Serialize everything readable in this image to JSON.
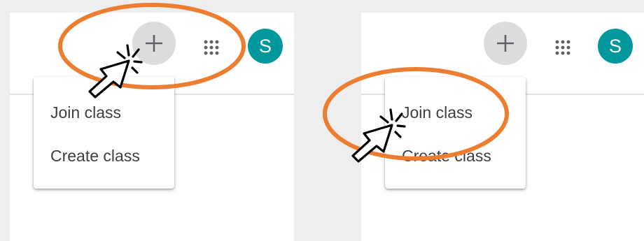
{
  "colors": {
    "avatar_bg": "#00979d",
    "icon": "#5f6368",
    "annotation": "#ed7d31"
  },
  "panels": [
    {
      "plus_icon": "plus-icon",
      "apps_icon": "apps-grid-icon",
      "avatar_letter": "S",
      "menu": {
        "items": [
          {
            "label": "Join class"
          },
          {
            "label": "Create class"
          }
        ]
      }
    },
    {
      "plus_icon": "plus-icon",
      "apps_icon": "apps-grid-icon",
      "avatar_letter": "S",
      "menu": {
        "items": [
          {
            "label": "Join class"
          },
          {
            "label": "Create class"
          }
        ]
      }
    }
  ]
}
